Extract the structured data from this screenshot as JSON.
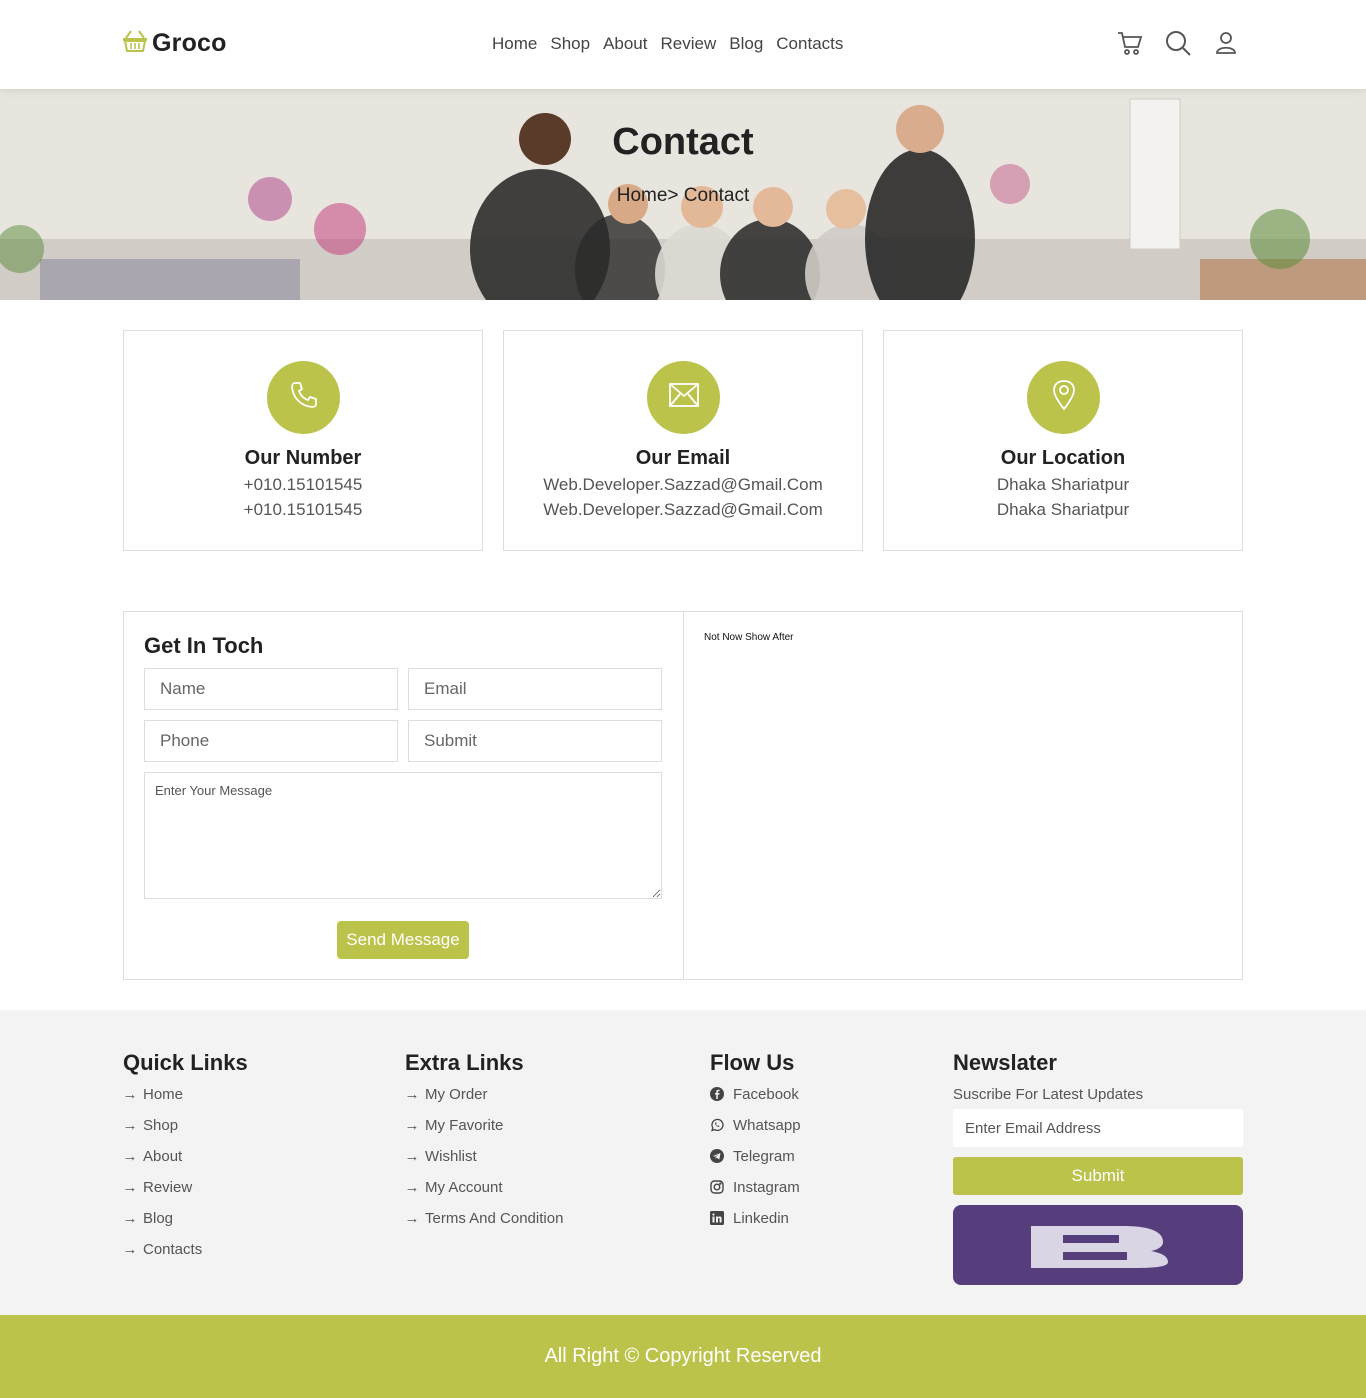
{
  "brand": {
    "name": "Groco",
    "accent": "#bbc34b"
  },
  "nav": [
    "Home",
    "Shop",
    "About",
    "Review",
    "Blog",
    "Contacts"
  ],
  "header_icons": [
    "cart-icon",
    "search-icon",
    "user-icon"
  ],
  "hero": {
    "title": "Contact",
    "breadcrumb": "Home> Contact"
  },
  "cards": [
    {
      "title": "Our Number",
      "icon": "phone-icon",
      "lines": [
        "+010.15101545",
        "+010.15101545"
      ]
    },
    {
      "title": "Our Email",
      "icon": "envelope-icon",
      "lines": [
        "Web.Developer.Sazzad@Gmail.Com",
        "Web.Developer.Sazzad@Gmail.Com"
      ]
    },
    {
      "title": "Our Location",
      "icon": "location-pin-icon",
      "lines": [
        "Dhaka Shariatpur",
        "Dhaka Shariatpur"
      ]
    }
  ],
  "form": {
    "title": "Get In Toch",
    "name_placeholder": "Name",
    "email_placeholder": "Email",
    "phone_placeholder": "Phone",
    "subject_placeholder": "Submit",
    "message_placeholder": "Enter Your Message",
    "send_label": "Send Message"
  },
  "map": {
    "text": "Not Now Show After"
  },
  "footer": {
    "quick": {
      "title": "Quick Links",
      "items": [
        "Home",
        "Shop",
        "About",
        "Review",
        "Blog",
        "Contacts"
      ]
    },
    "extra": {
      "title": "Extra Links",
      "items": [
        "My Order",
        "My Favorite",
        "Wishlist",
        "My Account",
        "Terms And Condition"
      ]
    },
    "follow": {
      "title": "Flow Us",
      "items": [
        {
          "label": "Facebook",
          "icon": "facebook-icon"
        },
        {
          "label": "Whatsapp",
          "icon": "whatsapp-icon"
        },
        {
          "label": "Telegram",
          "icon": "telegram-icon"
        },
        {
          "label": "Instagram",
          "icon": "instagram-icon"
        },
        {
          "label": "Linkedin",
          "icon": "linkedin-icon"
        }
      ]
    },
    "newsletter": {
      "title": "Newslater",
      "subtitle": "Suscribe For Latest Updates",
      "placeholder": "Enter Email Address",
      "submit_label": "Submit"
    }
  },
  "copyright": "All Right © Copyright Reserved"
}
